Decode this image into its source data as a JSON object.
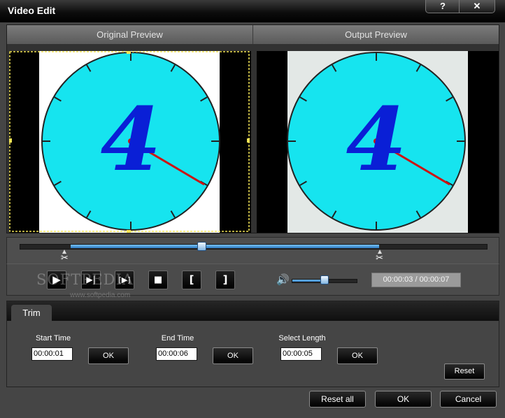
{
  "window": {
    "title": "Video Edit",
    "help_label": "?",
    "close_label": "✕"
  },
  "preview": {
    "original_label": "Original Preview",
    "output_label": "Output Preview",
    "frame_digit": "4"
  },
  "seek": {
    "position_percent": 39,
    "trim_start_percent": 11,
    "trim_end_percent": 77
  },
  "controls": {
    "play_label": "▶",
    "next_frame_label": "▶|",
    "goto_end_label": "[▶]",
    "stop_label": "■",
    "mark_in_label": "[",
    "mark_out_label": "]",
    "volume_icon": "🔊",
    "volume_percent": 50,
    "time_display": "00:00:03 / 00:00:07"
  },
  "watermark": {
    "text": "SOFTPEDIA",
    "url": "www.softpedia.com"
  },
  "trim": {
    "tab_label": "Trim",
    "start_label": "Start Time",
    "start_value": "00:00:01",
    "end_label": "End Time",
    "end_value": "00:00:06",
    "length_label": "Select Length",
    "length_value": "00:00:05",
    "ok_label": "OK",
    "reset_label": "Reset"
  },
  "footer": {
    "reset_all_label": "Reset all",
    "ok_label": "OK",
    "cancel_label": "Cancel"
  },
  "colors": {
    "accent": "#2b78c2",
    "clock_face": "#16e4ef",
    "digit": "#0a1fd6",
    "hand": "#cc1414"
  }
}
